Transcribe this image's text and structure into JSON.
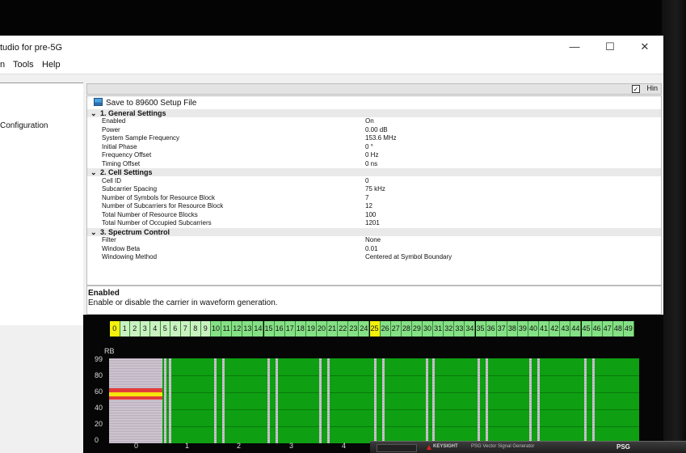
{
  "window": {
    "title": "tudio for pre-5G",
    "controls": {
      "minimize": "—",
      "maximize": "☐",
      "close": "✕"
    }
  },
  "menu": [
    "n",
    "Tools",
    "Help"
  ],
  "left_pane": {
    "tree_item": "Configuration"
  },
  "header_strip": {
    "checkbox_mark": "✓",
    "label": "Hin"
  },
  "property_panel": {
    "save_button": "Save to 89600 Setup File",
    "sections": [
      {
        "title": "1. General Settings",
        "rows": [
          {
            "name": "Enabled",
            "value": "On"
          },
          {
            "name": "Power",
            "value": "0.00 dB"
          },
          {
            "name": "System Sample Frequency",
            "value": "153.6 MHz"
          },
          {
            "name": "Initial Phase",
            "value": "0 °"
          },
          {
            "name": "Frequency Offset",
            "value": "0 Hz"
          },
          {
            "name": "Timing Offset",
            "value": "0 ns"
          }
        ]
      },
      {
        "title": "2. Cell Settings",
        "rows": [
          {
            "name": "Cell ID",
            "value": "0"
          },
          {
            "name": "Subcarrier Spacing",
            "value": "75 kHz"
          },
          {
            "name": "Number of Symbols for Resource Block",
            "value": "7"
          },
          {
            "name": "Number of Subcarriers for Resource Block",
            "value": "12"
          },
          {
            "name": "Total Number of Resource Blocks",
            "value": "100"
          },
          {
            "name": "Total Number of Occupied Subcarriers",
            "value": "1201"
          }
        ]
      },
      {
        "title": "3. Spectrum Control",
        "rows": [
          {
            "name": "Filter",
            "value": "None"
          },
          {
            "name": "Window Beta",
            "value": "0.01"
          },
          {
            "name": "Windowing Method",
            "value": "Centered at Symbol Boundary"
          }
        ]
      }
    ]
  },
  "description": {
    "title": "Enabled",
    "text": "Enable or disable the carrier in waveform generation."
  },
  "subframe_bar": {
    "labels": [
      "0",
      "1",
      "2",
      "3",
      "4",
      "5",
      "6",
      "7",
      "8",
      "9",
      "10",
      "11",
      "12",
      "13",
      "14",
      "15",
      "16",
      "17",
      "18",
      "19",
      "20",
      "21",
      "22",
      "23",
      "24",
      "25",
      "26",
      "27",
      "28",
      "29",
      "30",
      "31",
      "32",
      "33",
      "34",
      "35",
      "36",
      "37",
      "38",
      "39",
      "40",
      "41",
      "42",
      "43",
      "44",
      "45",
      "46",
      "47",
      "48",
      "49"
    ],
    "highlighted": [
      "0",
      "25"
    ],
    "light": [
      "1",
      "2",
      "3",
      "4",
      "5",
      "6",
      "7",
      "8",
      "9"
    ],
    "colors": {
      "normal": "#86e086",
      "highlight": "#f5f00c",
      "light": "#c9f2c0"
    }
  },
  "resource_grid": {
    "y_axis_label": "RB",
    "y_ticks": [
      "99",
      "80",
      "60",
      "40",
      "20",
      "0"
    ],
    "x_ticks": [
      "0",
      "1",
      "2",
      "3",
      "4"
    ],
    "colors": {
      "data": "#0ea012",
      "control": "#b5a8b8",
      "sync": "#f5e50c",
      "sync_red": "#e23b3b"
    }
  },
  "device_overlay": {
    "brand": "KEYSIGHT",
    "title": "PSG Vector Signal Generator",
    "model": "PSG"
  }
}
